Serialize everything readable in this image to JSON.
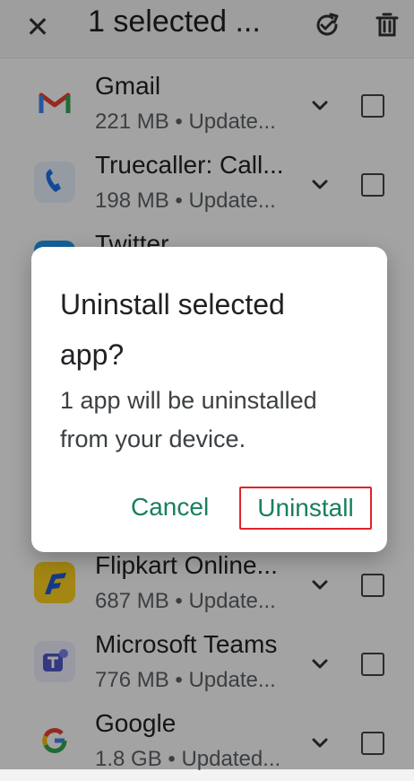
{
  "header": {
    "title": "1 selected ...",
    "close_icon": "close-icon",
    "refresh_icon": "refresh-icon",
    "trash_icon": "trash-icon"
  },
  "apps": [
    {
      "name": "Gmail",
      "meta": "221 MB • Update...",
      "icon": "gmail-icon"
    },
    {
      "name": "Truecaller: Call...",
      "meta": "198 MB • Update...",
      "icon": "truecaller-icon"
    },
    {
      "name": "Twitter",
      "meta": "",
      "icon": "twitter-icon"
    },
    {
      "name": "Flipkart Online...",
      "meta": "687 MB • Update...",
      "icon": "flipkart-icon"
    },
    {
      "name": "Microsoft Teams",
      "meta": "776 MB • Update...",
      "icon": "teams-icon"
    },
    {
      "name": "Google",
      "meta": "1.8 GB • Updated...",
      "icon": "google-icon"
    }
  ],
  "dialog": {
    "title": "Uninstall selected app?",
    "body": "1 app will be uninstalled from your device.",
    "cancel_label": "Cancel",
    "uninstall_label": "Uninstall"
  },
  "colors": {
    "accent_green": "#18805b",
    "highlight_red": "#e0242a"
  }
}
